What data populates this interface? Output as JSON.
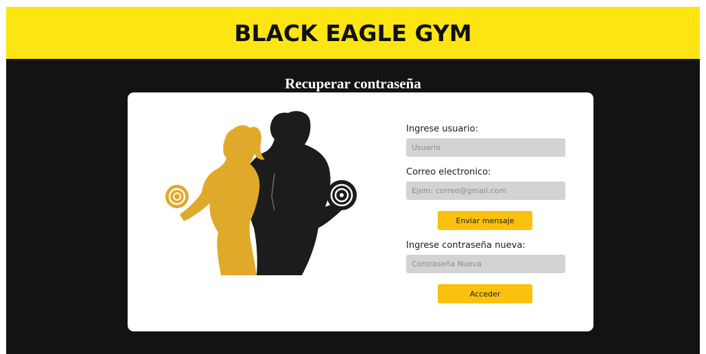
{
  "header": {
    "title": "BLACK EAGLE GYM"
  },
  "page": {
    "subtitle": "Recuperar contraseña"
  },
  "form": {
    "user_label": "Ingrese usuario:",
    "user_placeholder": "Usuario",
    "email_label": "Correo electronico:",
    "email_placeholder": "Ejem: correo@gmail.com",
    "send_button": "Enviar mensaje",
    "new_password_label": "Ingrese contraseña nueva:",
    "new_password_placeholder": "Contraseña Nueva",
    "submit_button": "Acceder"
  },
  "illustration": {
    "icon": "gym-couple-dumbbells-illustration"
  },
  "colors": {
    "header_bg": "#fde514",
    "page_bg": "#131313",
    "button_bg": "#fbc10f",
    "input_bg": "#d3d3d3",
    "woman_silhouette": "#e0a92a",
    "man_silhouette": "#1c1c1c"
  }
}
